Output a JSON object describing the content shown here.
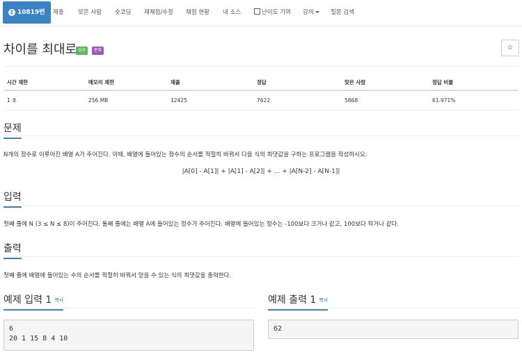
{
  "nav": {
    "problem_number": "10819번",
    "items": [
      "제출",
      "맞은 사람",
      "숏코딩",
      "재채점/수정",
      "채점 현황",
      "내 소스",
      "난이도 기여",
      "강의",
      "질문 검색"
    ]
  },
  "problem": {
    "title": "차이를 최대로",
    "badge_success": "성공",
    "badge_tag": "분류",
    "star": "☆"
  },
  "stats": {
    "headers": [
      "시간 제한",
      "메모리 제한",
      "제출",
      "정답",
      "맞은 사람",
      "정답 비율"
    ],
    "values": [
      "1 초",
      "256 MB",
      "12425",
      "7622",
      "5868",
      "61.971%"
    ]
  },
  "sections": {
    "problem_title": "문제",
    "problem_text": "N개의 정수로 이루어진 배열 A가 주어진다. 이때, 배열에 들어있는 정수의 순서를 적절히 바꿔서 다음 식의 최댓값을 구하는 프로그램을 작성하시오.",
    "formula": "|A[0] - A[1]| + |A[1] - A[2]| + ... + |A[N-2] - A[N-1]|",
    "input_title": "입력",
    "input_text": "첫째 줄에 N (3 ≤ N ≤ 8)이 주어진다. 둘째 줄에는 배열 A에 들어있는 정수가 주어진다. 배열에 들어있는 정수는 -100보다 크거나 같고, 100보다 작거나 같다.",
    "output_title": "출력",
    "output_text": "첫째 줄에 배열에 들어있는 수의 순서를 적절히 바꿔서 얻을 수 있는 식의 최댓값을 출력한다.",
    "sample_input_title": "예제 입력 1",
    "sample_output_title": "예제 출력 1",
    "copy_label": "복사",
    "sample_input": "6\n20 1 15 8 4 10",
    "sample_output": "62"
  }
}
